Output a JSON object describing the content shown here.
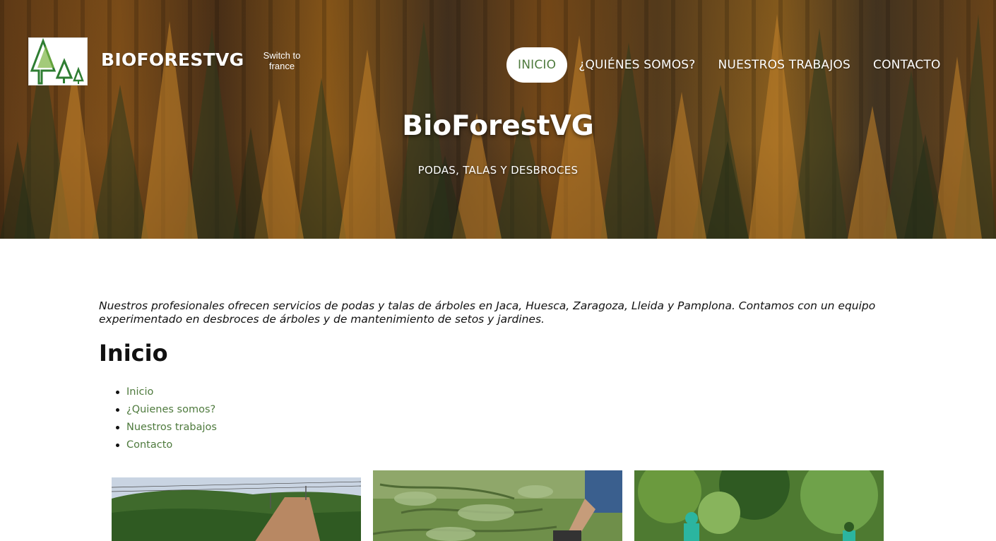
{
  "header": {
    "brand": "BIOFORESTVG",
    "switch_language": "Switch to france",
    "nav": [
      {
        "label": "INICIO",
        "active": true
      },
      {
        "label": "¿QUIÉNES SOMOS?",
        "active": false
      },
      {
        "label": "NUESTROS TRABAJOS",
        "active": false
      },
      {
        "label": "CONTACTO",
        "active": false
      }
    ]
  },
  "hero": {
    "title": "BioForestVG",
    "subtitle": "PODAS, TALAS Y DESBROCES"
  },
  "main": {
    "intro": "Nuestros profesionales ofrecen servicios de podas y talas de árboles en Jaca, Huesca, Zaragoza, Lleida y Pamplona. Contamos con un equipo experimentado en desbroces de árboles y de mantenimiento de setos y jardines.",
    "section_title": "Inicio",
    "links": [
      "Inicio",
      "¿Quienes somos?",
      "Nuestros trabajos",
      "Contacto"
    ]
  },
  "colors": {
    "accent_green": "#4e7a3d",
    "hero_forest": "#9a5f1e"
  }
}
